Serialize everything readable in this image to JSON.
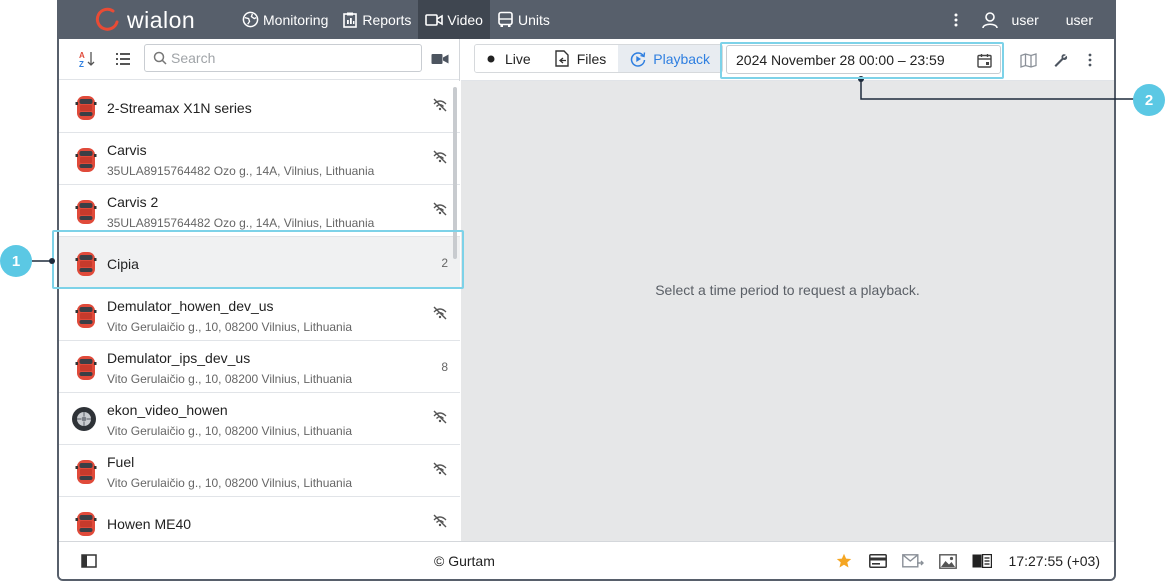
{
  "app": {
    "logo_text": "wialon"
  },
  "nav": [
    {
      "label": "Monitoring",
      "icon": "globe-icon"
    },
    {
      "label": "Reports",
      "icon": "report-icon"
    },
    {
      "label": "Video",
      "icon": "video-icon"
    },
    {
      "label": "Units",
      "icon": "bus-icon"
    }
  ],
  "user": {
    "login": "user",
    "name": "user"
  },
  "left": {
    "search_placeholder": "Search"
  },
  "units": [
    {
      "name": "2-Streamax X1N series",
      "address": "",
      "status": "offline"
    },
    {
      "name": "Carvis",
      "address": "35ULA8915764482 Ozo g., 14A, Vilnius, Lithuania",
      "status": "offline"
    },
    {
      "name": "Carvis 2",
      "address": "35ULA8915764482 Ozo g., 14A, Vilnius, Lithuania",
      "status": "offline"
    },
    {
      "name": "Cipia",
      "address": "",
      "status": "2"
    },
    {
      "name": "Demulator_howen_dev_us",
      "address": "Vito Gerulaičio g., 10, 08200 Vilnius, Lithuania",
      "status": "offline"
    },
    {
      "name": "Demulator_ips_dev_us",
      "address": "Vito Gerulaičio g., 10, 08200 Vilnius, Lithuania",
      "status": "8"
    },
    {
      "name": "ekon_video_howen",
      "address": "Vito Gerulaičio g., 10, 08200 Vilnius, Lithuania",
      "status": "offline"
    },
    {
      "name": "Fuel",
      "address": "Vito Gerulaičio g., 10, 08200 Vilnius, Lithuania",
      "status": "offline"
    },
    {
      "name": "Howen ME40",
      "address": "",
      "status": "offline"
    }
  ],
  "right": {
    "tabs": [
      {
        "label": "Live"
      },
      {
        "label": "Files"
      },
      {
        "label": "Playback"
      }
    ],
    "date_range": "2024 November 28 00:00 – 23:59",
    "placeholder": "Select a time period to request a playback."
  },
  "bottom": {
    "copyright": "© Gurtam",
    "time": "17:27:55 (+03)"
  },
  "callouts": {
    "one": "1",
    "two": "2"
  },
  "colors": {
    "topbar": "#575f6b",
    "accent": "#2f7fe0",
    "callout": "#5bc8e4",
    "car_red": "#e04a3a",
    "star": "#f5a623"
  }
}
